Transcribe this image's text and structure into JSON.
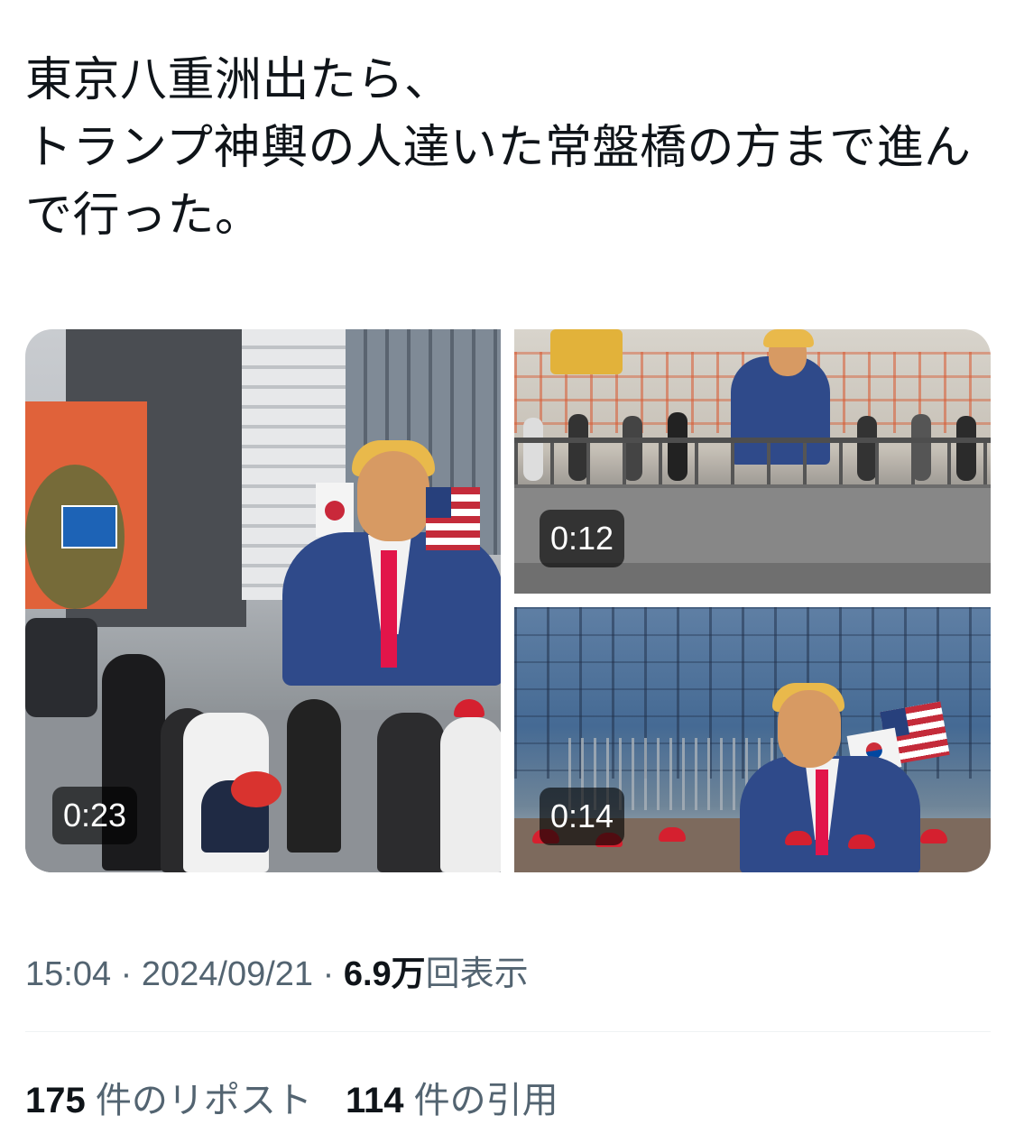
{
  "tweet": {
    "text_lines": [
      "東京八重洲出たら、",
      "トランプ神輿の人達いた常盤橋の方まで進ん",
      "で行った。"
    ]
  },
  "media": [
    {
      "duration": "0:23"
    },
    {
      "duration": "0:12"
    },
    {
      "duration": "0:14"
    }
  ],
  "meta": {
    "time": "15:04",
    "separator": "·",
    "date": "2024/09/21",
    "views_count": "6.9万",
    "views_label": "回表示"
  },
  "stats": {
    "reposts_count": "175",
    "reposts_label": "件のリポスト",
    "quotes_count": "114",
    "quotes_label": "件の引用"
  },
  "colors": {
    "text": "#0f1419",
    "secondary_text": "#536471",
    "divider": "#eff3f4",
    "badge_bg": "rgba(0,0,0,0.62)"
  }
}
